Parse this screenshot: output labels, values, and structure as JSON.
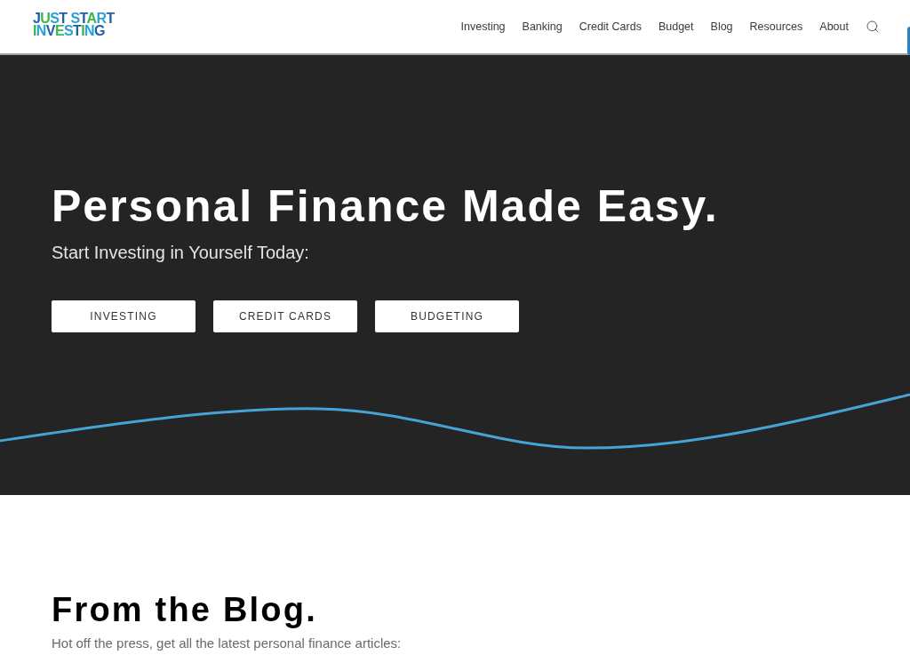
{
  "header": {
    "logo": {
      "line_1": "JUST START",
      "line_2": "INVESTING"
    },
    "nav": [
      {
        "label": "Investing"
      },
      {
        "label": "Banking"
      },
      {
        "label": "Credit Cards"
      },
      {
        "label": "Budget"
      },
      {
        "label": "Blog"
      },
      {
        "label": "Resources"
      },
      {
        "label": "About"
      }
    ]
  },
  "hero": {
    "title": "Personal Finance Made Easy.",
    "subtitle": "Start Investing in Yourself Today:",
    "buttons": [
      {
        "label": "INVESTING"
      },
      {
        "label": "CREDIT CARDS"
      },
      {
        "label": "BUDGETING"
      }
    ]
  },
  "blog": {
    "title": "From the Blog.",
    "subtitle": "Hot off the press, get all the latest personal finance articles:"
  }
}
